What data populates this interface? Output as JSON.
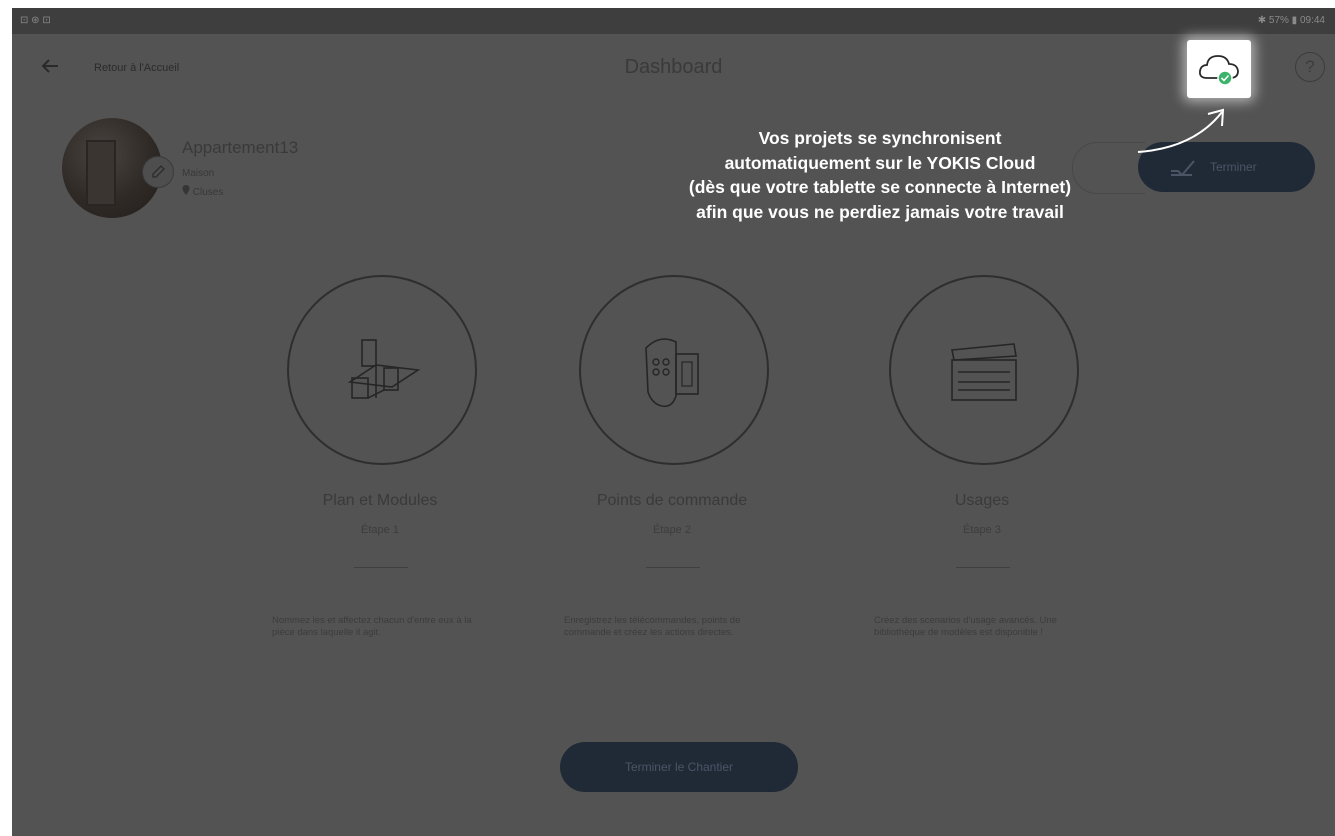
{
  "statusbar": {
    "left": "⊡ ⊛ ⊡",
    "right": "✱ 57% ▮ 09:44"
  },
  "header": {
    "back_label": "Retour à l'Accueil",
    "title": "Dashboard"
  },
  "project": {
    "name": "Appartement13",
    "type": "Maison",
    "location": "Cluses"
  },
  "finish_top_label": "Terminer",
  "steps": [
    {
      "title": "Plan et Modules",
      "step": "Étape 1",
      "description": "Nommez les et affectez chacun d'entre eux à la pièce dans laquelle il agit."
    },
    {
      "title": "Points de commande",
      "step": "Étape 2",
      "description": "Enregistrez les télécommandes, points de commande et créez les actions directes."
    },
    {
      "title": "Usages",
      "step": "Étape 3",
      "description": "Créez des scenarios d'usage avancés. Une bibliothèque de modèles est disponible !"
    }
  ],
  "finish_bottom_label": "Terminer le Chantier",
  "tooltip": {
    "lines": [
      "Vos projets se synchronisent",
      "automatiquement sur le YOKIS Cloud",
      "(dès que votre tablette se connecte à Internet)",
      "afin que vous ne perdiez jamais votre travail"
    ]
  },
  "colors": {
    "overlay": "#535353",
    "button_bg": "#202a36",
    "cloud_check": "#3bb36a",
    "tooltip_text": "#ffffff"
  },
  "icons": [
    "back-arrow-icon",
    "cloud-sync-icon",
    "help-icon",
    "location-pin-icon",
    "edit-icon",
    "modules-plan-icon",
    "remote-control-icon",
    "usage-scenes-icon"
  ]
}
